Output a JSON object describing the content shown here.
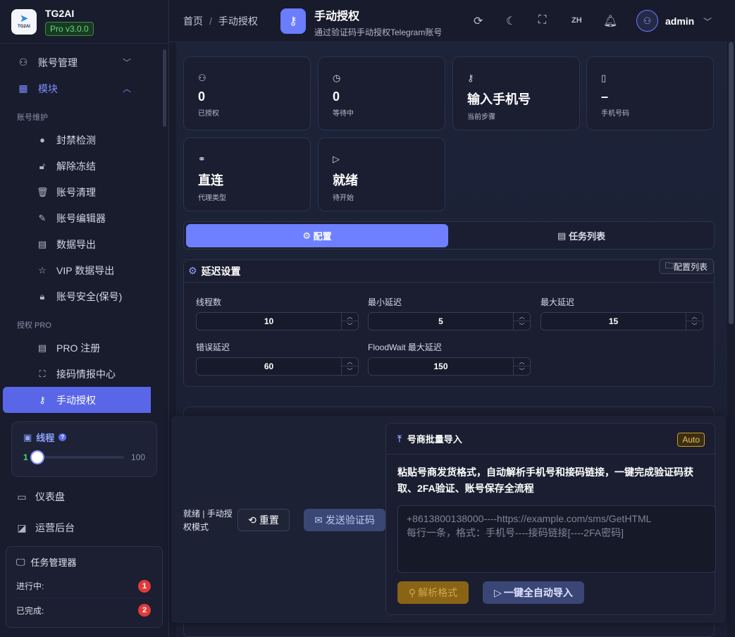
{
  "brand": {
    "logo_text": "TG2AI",
    "name": "TG2AI",
    "version": "Pro v3.0.0"
  },
  "sidebar": {
    "account_mgmt": "账号管理",
    "modules": "模块",
    "group_maintain": "账号维护",
    "items_maintain": [
      "封禁检测",
      "解除冻结",
      "账号清理",
      "账号编辑器",
      "数据导出",
      "VIP 数据导出",
      "账号安全(保号)"
    ],
    "group_pro": "授权 PRO",
    "items_pro": [
      "PRO 注册",
      "接码情报中心",
      "手动授权"
    ],
    "thread": {
      "label": "线程",
      "min": "1",
      "max": "100",
      "value": 1
    },
    "dashboard": "仪表盘",
    "ops": "运营后台",
    "task_manager": {
      "title": "任务管理器",
      "running_label": "进行中:",
      "running_count": "1",
      "done_label": "已完成:",
      "done_count": "2"
    }
  },
  "topbar": {
    "breadcrumb_home": "首页",
    "breadcrumb_sep": "/",
    "breadcrumb_current": "手动授权",
    "page_title": "手动授权",
    "page_subtitle": "通过验证码手动授权Telegram账号",
    "lang": "ZH",
    "username": "admin"
  },
  "stats": [
    {
      "value": "0",
      "label": "已授权",
      "icon": "user-icon"
    },
    {
      "value": "0",
      "label": "等待中",
      "icon": "clock-icon"
    },
    {
      "value": "输入手机号",
      "label": "当前步骤",
      "icon": "key-icon"
    },
    {
      "value": "–",
      "label": "手机号码",
      "icon": "phone-icon"
    },
    {
      "value": "直连",
      "label": "代理类型",
      "icon": "link-icon"
    },
    {
      "value": "就绪",
      "label": "待开始",
      "icon": "play-icon"
    }
  ],
  "tabs": {
    "config": "配置",
    "tasks": "任务列表"
  },
  "delay": {
    "title": "延迟设置",
    "config_list": "配置列表",
    "fields": [
      {
        "label": "线程数",
        "value": "10"
      },
      {
        "label": "最小延迟",
        "value": "5"
      },
      {
        "label": "最大延迟",
        "value": "15"
      },
      {
        "label": "错误延迟",
        "value": "60"
      },
      {
        "label": "FloodWait 最大延迟",
        "value": "150"
      }
    ]
  },
  "dock": {
    "status": "就绪 | 手动授权模式",
    "reset": "重置",
    "send_code": "发送验证码"
  },
  "import": {
    "title": "号商批量导入",
    "auto_badge": "Auto",
    "desc": "粘贴号商发货格式，自动解析手机号和接码链接，一键完成验证码获取、2FA验证、账号保存全流程",
    "placeholder_line1": "+8613800138000----https://example.com/sms/GetHTML",
    "placeholder_line2": "每行一条，格式：手机号----接码链接[----2FA密码]",
    "parse_btn": "解析格式",
    "auto_btn": "一键全自动导入"
  },
  "colors": {
    "accent": "#6e80ff",
    "bg": "#171b2c",
    "success": "#4bdc6a",
    "warning": "#c99a2a",
    "danger": "#e03a3a"
  }
}
